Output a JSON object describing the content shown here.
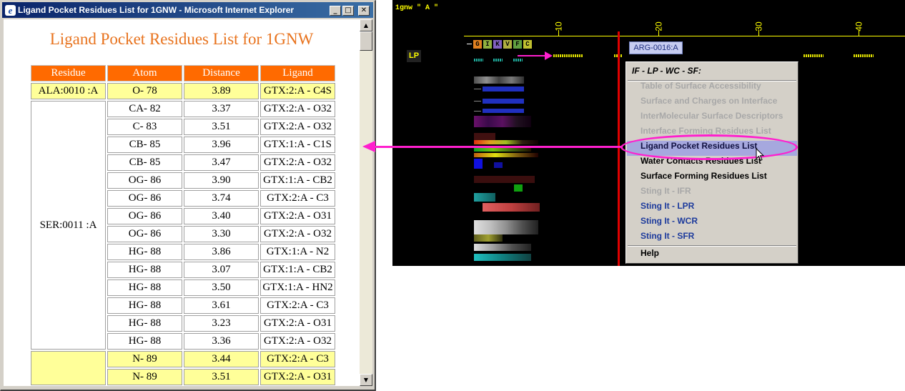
{
  "ie_window": {
    "title": "Ligand Pocket Residues List for 1GNW - Microsoft Internet Explorer",
    "icon": "ie-icon",
    "buttons": {
      "minimize": "_",
      "maximize": "□",
      "close": "✕"
    }
  },
  "page": {
    "heading": "Ligand Pocket Residues List for 1GNW",
    "columns": [
      "Residue",
      "Atom",
      "Distance",
      "Ligand"
    ],
    "groups": [
      {
        "residue": "ALA:0010 :A",
        "highlight": true,
        "rows": [
          {
            "atom": "O- 78",
            "distance": "3.89",
            "ligand": "GTX:2:A - C4S"
          }
        ]
      },
      {
        "residue": "SER:0011 :A",
        "highlight": false,
        "rows": [
          {
            "atom": "CA- 82",
            "distance": "3.37",
            "ligand": "GTX:2:A - O32"
          },
          {
            "atom": "C- 83",
            "distance": "3.51",
            "ligand": "GTX:2:A - O32"
          },
          {
            "atom": "CB- 85",
            "distance": "3.96",
            "ligand": "GTX:1:A - C1S"
          },
          {
            "atom": "CB- 85",
            "distance": "3.47",
            "ligand": "GTX:2:A - O32"
          },
          {
            "atom": "OG- 86",
            "distance": "3.90",
            "ligand": "GTX:1:A - CB2"
          },
          {
            "atom": "OG- 86",
            "distance": "3.74",
            "ligand": "GTX:2:A - C3"
          },
          {
            "atom": "OG- 86",
            "distance": "3.40",
            "ligand": "GTX:2:A - O31"
          },
          {
            "atom": "OG- 86",
            "distance": "3.30",
            "ligand": "GTX:2:A - O32"
          },
          {
            "atom": "HG- 88",
            "distance": "3.86",
            "ligand": "GTX:1:A - N2"
          },
          {
            "atom": "HG- 88",
            "distance": "3.07",
            "ligand": "GTX:1:A - CB2"
          },
          {
            "atom": "HG- 88",
            "distance": "3.50",
            "ligand": "GTX:1:A - HN2"
          },
          {
            "atom": "HG- 88",
            "distance": "3.61",
            "ligand": "GTX:2:A - C3"
          },
          {
            "atom": "HG- 88",
            "distance": "3.23",
            "ligand": "GTX:2:A - O31"
          },
          {
            "atom": "HG- 88",
            "distance": "3.36",
            "ligand": "GTX:2:A - O32"
          }
        ]
      },
      {
        "residue": "",
        "highlight": true,
        "rows": [
          {
            "atom": "N- 89",
            "distance": "3.44",
            "ligand": "GTX:2:A - C3"
          },
          {
            "atom": "N- 89",
            "distance": "3.51",
            "ligand": "GTX:2:A - O31"
          }
        ]
      }
    ]
  },
  "sting": {
    "label": "1gnw \" A \"",
    "ruler_ticks": [
      "10",
      "20",
      "30",
      "40"
    ],
    "sequence": [
      {
        "letter": "G",
        "color": "#e08020"
      },
      {
        "letter": "I",
        "color": "#90b040"
      },
      {
        "letter": "K",
        "color": "#8060c0"
      },
      {
        "letter": "V",
        "color": "#b0b040"
      },
      {
        "letter": "F",
        "color": "#60a040"
      },
      {
        "letter": "C",
        "color": "#c0c030"
      }
    ],
    "track_label": "LP",
    "tooltip": "ARG-0016:A",
    "colors": {
      "accent_pink": "#ff1fce",
      "marker_red": "#e00000",
      "ruler_yellow": "#ffff00"
    }
  },
  "menu": {
    "header": "IF - LP - WC - SF:",
    "items": [
      {
        "label": "Table of Surface Accessibility",
        "state": "disabled"
      },
      {
        "label": "Surface and Charges on Interface",
        "state": "disabled"
      },
      {
        "label": "InterMolecular Surface Descriptors",
        "state": "disabled"
      },
      {
        "label": "Interface Forming Residues List",
        "state": "disabled"
      },
      {
        "label": "Ligand Pocket Residues List",
        "state": "selected"
      },
      {
        "label": "Water Contacts Residues List",
        "state": "normal"
      },
      {
        "label": "Surface Forming Residues List",
        "state": "normal"
      },
      {
        "label": "Sting It - IFR",
        "state": "disabled"
      },
      {
        "label": "Sting It - LPR",
        "state": "sting"
      },
      {
        "label": "Sting It - WCR",
        "state": "sting"
      },
      {
        "label": "Sting It - SFR",
        "state": "sting"
      }
    ],
    "help": "Help"
  }
}
